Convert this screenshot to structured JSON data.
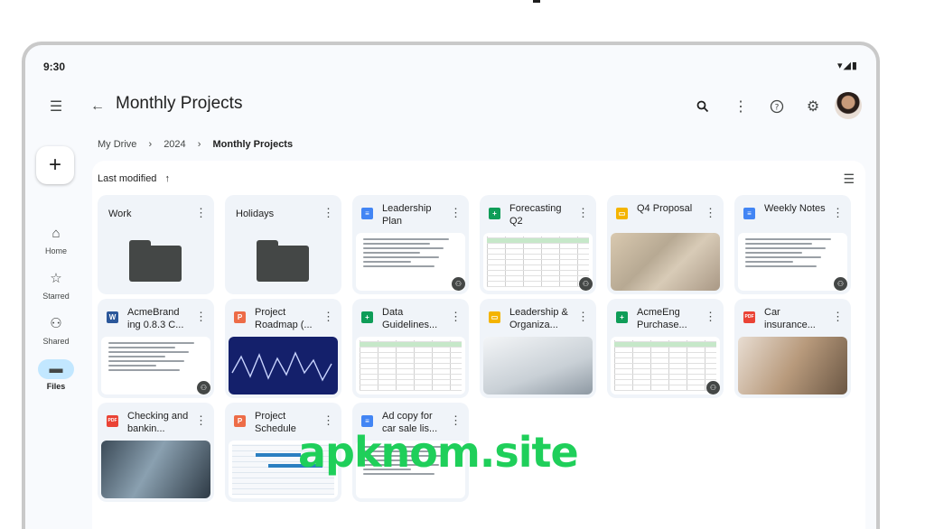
{
  "status": {
    "time": "9:30",
    "icons": "▾◢▮"
  },
  "header": {
    "title": "Monthly Projects",
    "icons": [
      "menu-icon",
      "back-arrow-icon",
      "search-icon",
      "more-vert-icon",
      "help-icon",
      "settings-icon",
      "avatar"
    ]
  },
  "breadcrumb": {
    "items": [
      "My Drive",
      "2024",
      "Monthly Projects"
    ],
    "sep": "›"
  },
  "sidebar": {
    "new_label": "+",
    "items": [
      {
        "label": "Home",
        "icon": "⌂"
      },
      {
        "label": "Starred",
        "icon": "☆"
      },
      {
        "label": "Shared",
        "icon": "⚇"
      },
      {
        "label": "Files",
        "icon": "▬"
      }
    ]
  },
  "sort": {
    "label": "Last modified",
    "arrow": "↑"
  },
  "files": [
    {
      "name": "Work",
      "type": "folder"
    },
    {
      "name": "Holidays",
      "type": "folder"
    },
    {
      "name": "Leadership Plan",
      "type": "doc",
      "shared": true
    },
    {
      "name": "Forecasting Q2",
      "type": "sheet",
      "shared": true
    },
    {
      "name": "Q4 Proposal",
      "type": "slide",
      "shared": false
    },
    {
      "name": "Weekly Notes",
      "type": "doc",
      "shared": true
    },
    {
      "name": "AcmeBrand ing 0.8.3 C...",
      "type": "word",
      "shared": true
    },
    {
      "name": "Project Roadmap (...",
      "type": "ppt",
      "shared": false
    },
    {
      "name": "Data Guidelines...",
      "type": "sheet",
      "shared": false
    },
    {
      "name": "Leadership & Organiza...",
      "type": "slide",
      "shared": false
    },
    {
      "name": "AcmeEng Purchase...",
      "type": "sheet",
      "shared": true
    },
    {
      "name": "Car insurance...",
      "type": "pdf",
      "shared": false
    },
    {
      "name": "Checking and bankin...",
      "type": "pdf",
      "shared": false
    },
    {
      "name": "Project Schedule",
      "type": "ppt",
      "shared": false
    },
    {
      "name": "Ad copy for car sale lis...",
      "type": "doc",
      "shared": false
    }
  ],
  "type_glyphs": {
    "doc": "≡",
    "sheet": "+",
    "slide": "▭",
    "pdf": "PDF",
    "word": "W",
    "ppt": "P"
  },
  "thumb_styles": [
    "doc",
    "sheet",
    "map",
    "doc",
    "doc",
    "chart",
    "sheet",
    "paper",
    "sheet",
    "photo",
    "desk",
    "schedule",
    "doc"
  ],
  "colors": {
    "accent": "#c2e7ff",
    "watermark": "#1fcf5a"
  },
  "watermark": "apknom.site"
}
